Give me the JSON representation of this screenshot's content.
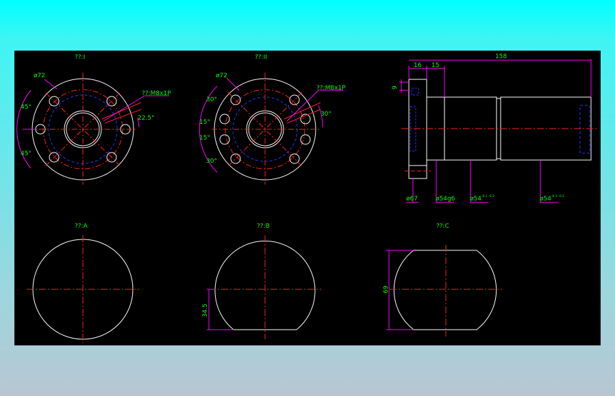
{
  "colors": {
    "background": "#000000",
    "outline": "#ffffff",
    "centerline": "#ff2020",
    "hidden": "#3030ff",
    "dimension": "#ff00ff",
    "text": "#00ff00"
  },
  "views": {
    "I": {
      "title": "??:I",
      "dia": "ø72",
      "thread": "??:M8x1P",
      "ang1": "45°",
      "ang2": "45°",
      "ang3": "22.5°"
    },
    "II": {
      "title": "??:II",
      "dia": "ø72",
      "thread": "??:M8x1P",
      "a1": "30°",
      "a2": "15°",
      "a3": "15°",
      "a4": "30°",
      "a5": "30°"
    },
    "side": {
      "len_total": "158",
      "len_a": "16",
      "len_b": "15",
      "thk": "9",
      "d1": "ø67",
      "d2": "ø54g6",
      "d3": "ø54",
      "d3_tol": "-0.1 -0.2",
      "d4": "ø54",
      "d4_tol": "-0.1 -0.2"
    },
    "A": {
      "title": "??:A"
    },
    "B": {
      "title": "??:B",
      "dim": "34.5"
    },
    "C": {
      "title": "??:C",
      "dim": "69"
    }
  }
}
